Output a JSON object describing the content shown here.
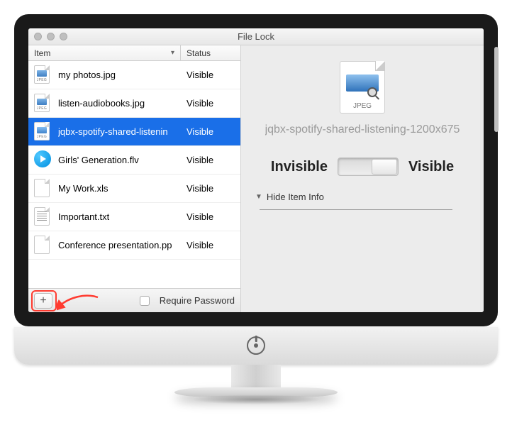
{
  "window": {
    "title": "File Lock"
  },
  "columns": {
    "item": "Item",
    "status": "Status"
  },
  "rows": [
    {
      "icon": "jpeg",
      "name": "my photos.jpg",
      "status": "Visible"
    },
    {
      "icon": "jpeg",
      "name": "listen-audiobooks.jpg",
      "status": "Visible"
    },
    {
      "icon": "jpeg",
      "name": "jqbx-spotify-shared-listenin",
      "status": "Visible",
      "selected": true
    },
    {
      "icon": "flv",
      "name": "Girls' Generation.flv",
      "status": "Visible"
    },
    {
      "icon": "blank",
      "name": "My Work.xls",
      "status": "Visible"
    },
    {
      "icon": "txt",
      "name": "Important.txt",
      "status": "Visible"
    },
    {
      "icon": "blank",
      "name": "Conference presentation.pp",
      "status": "Visible"
    }
  ],
  "bottom": {
    "add": "+",
    "require_password": "Require Password"
  },
  "preview": {
    "type_label": "JPEG",
    "filename": "jqbx-spotify-shared-listening-1200x675",
    "invisible": "Invisible",
    "visible": "Visible",
    "disclosure": "Hide Item Info"
  }
}
